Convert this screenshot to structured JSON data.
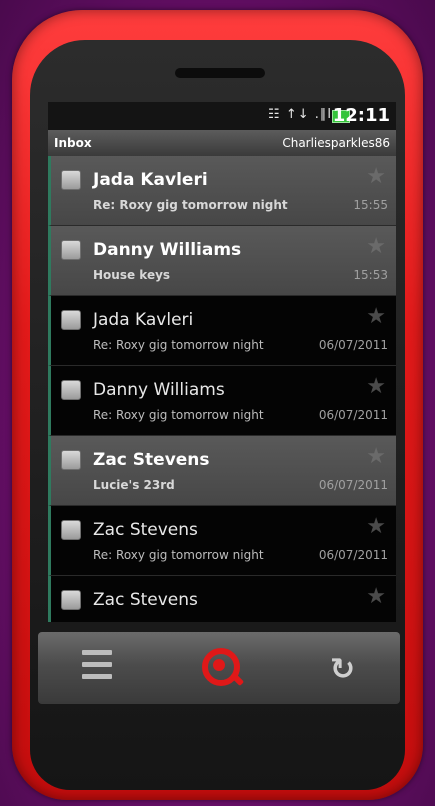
{
  "status_bar": {
    "icons": "☷ ↑↓ .∥l",
    "time": "12:11",
    "battery_color": "#35c43b"
  },
  "header": {
    "title": "Inbox",
    "account": "Charliesparkles86"
  },
  "messages": [
    {
      "sender": "Jada Kavleri",
      "subject": "Re: Roxy gig tomorrow night",
      "time": "15:55",
      "unread": true
    },
    {
      "sender": "Danny Williams",
      "subject": "House keys",
      "time": "15:53",
      "unread": true
    },
    {
      "sender": "Jada Kavleri",
      "subject": "Re: Roxy gig tomorrow night",
      "time": "06/07/2011",
      "unread": false
    },
    {
      "sender": "Danny Williams",
      "subject": "Re: Roxy gig tomorrow night",
      "time": "06/07/2011",
      "unread": false
    },
    {
      "sender": "Zac Stevens",
      "subject": "Lucie's 23rd",
      "time": "06/07/2011",
      "unread": true
    },
    {
      "sender": "Zac Stevens",
      "subject": "Re: Roxy gig tomorrow night",
      "time": "06/07/2011",
      "unread": false
    },
    {
      "sender": "Zac Stevens",
      "subject": "",
      "time": "",
      "unread": false
    }
  ],
  "nav": {
    "menu_icon": "menu-icon",
    "search_icon": "search-icon",
    "back_icon": "back-icon",
    "back_glyph": "↻",
    "accent": "#e01818"
  },
  "colors": {
    "phone_body": "#e21a1a",
    "background": "#6a0f6a",
    "unread_row": "#525252",
    "read_row": "#040404",
    "row_accent": "#2f7a5e"
  }
}
